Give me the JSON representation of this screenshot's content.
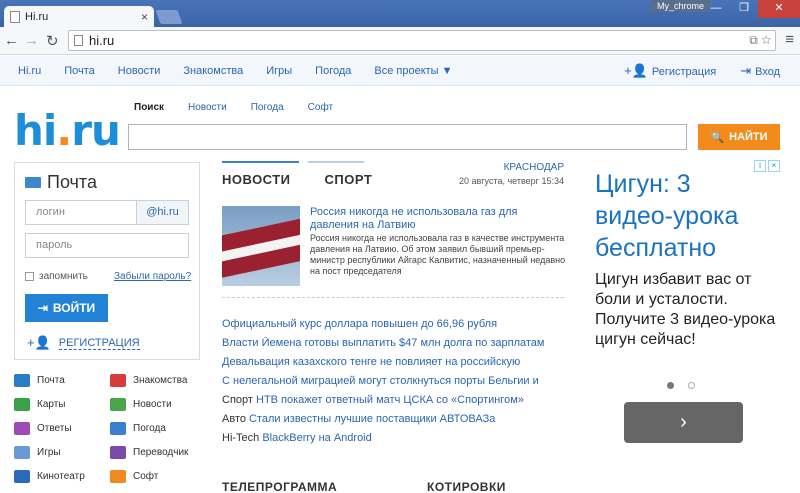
{
  "browser": {
    "tab_title": "Hi.ru",
    "tab_close": "×",
    "profile": "My_chrome",
    "url": "hi.ru",
    "window_buttons": [
      "—",
      "❐",
      "✕"
    ]
  },
  "sitenav": {
    "items": [
      "Hi.ru",
      "Почта",
      "Новости",
      "Знакомства",
      "Игры",
      "Погода",
      "Все проекты ▼"
    ],
    "register": "Регистрация",
    "login": "Вход"
  },
  "logo": {
    "main": "hi",
    "dot": ".",
    "tld": "ru"
  },
  "search": {
    "tabs": [
      "Поиск",
      "Новости",
      "Погода",
      "Софт"
    ],
    "button": "НАЙТИ"
  },
  "mail": {
    "title": "Почта",
    "login_placeholder": "логин",
    "domain": "@hi.ru",
    "password_placeholder": "пароль",
    "remember": "запомнить",
    "forgot": "Забыли пароль?",
    "login_button": "ВОЙТИ",
    "register": "РЕГИСТРАЦИЯ"
  },
  "services": [
    {
      "label": "Почта",
      "color": "#2a7bc8"
    },
    {
      "label": "Знакомства",
      "color": "#d93b3b"
    },
    {
      "label": "Карты",
      "color": "#3aa14a"
    },
    {
      "label": "Новости",
      "color": "#4aa64a"
    },
    {
      "label": "Ответы",
      "color": "#a04ab8"
    },
    {
      "label": "Погода",
      "color": "#3a7fd0"
    },
    {
      "label": "Игры",
      "color": "#6a9ad6"
    },
    {
      "label": "Переводчик",
      "color": "#7a4aa8"
    },
    {
      "label": "Кинотеатр",
      "color": "#2a6ab8"
    },
    {
      "label": "Софт",
      "color": "#f08a1c"
    }
  ],
  "news": {
    "tabs": [
      "НОВОСТИ",
      "СПОРТ"
    ],
    "city": "КРАСНОДАР",
    "date": "20 августа, четверг 15:34",
    "lead_title": "Россия никогда не использовала газ для давления на Латвию",
    "lead_text": "Россия никогда не использовала газ в качестве инструмента давления на Латвию. Об этом заявил бывший премьер-министр республики Айгарс Калвитис, назначенный недавно на пост председателя",
    "items": [
      {
        "cat": "",
        "text": "Официальный курс доллара повышен до 66,96 рубля"
      },
      {
        "cat": "",
        "text": "Власти Йемена готовы выплатить $47 млн долга по зарплатам"
      },
      {
        "cat": "",
        "text": "Девальвация казахского тенге не повлияет на российскую"
      },
      {
        "cat": "",
        "text": "С нелегальной миграцией могут столкнуться порты Бельгии и"
      },
      {
        "cat": "Спорт ",
        "text": "НТВ покажет ответный матч ЦСКА со «Спортингом»"
      },
      {
        "cat": "Авто ",
        "text": "Стали известны лучшие поставщики АВТОВАЗа"
      },
      {
        "cat": "Hi-Tech ",
        "text": "BlackBerry на Android"
      }
    ],
    "bottom": [
      "ТЕЛЕПРОГРАММА",
      "КОТИРОВКИ"
    ]
  },
  "ad": {
    "title": "Цигун: 3 видео-урока бесплатно",
    "body": "Цигун избавит вас от боли и усталости. Получите 3 видео-урока цигун сейчас!",
    "button": "›"
  }
}
